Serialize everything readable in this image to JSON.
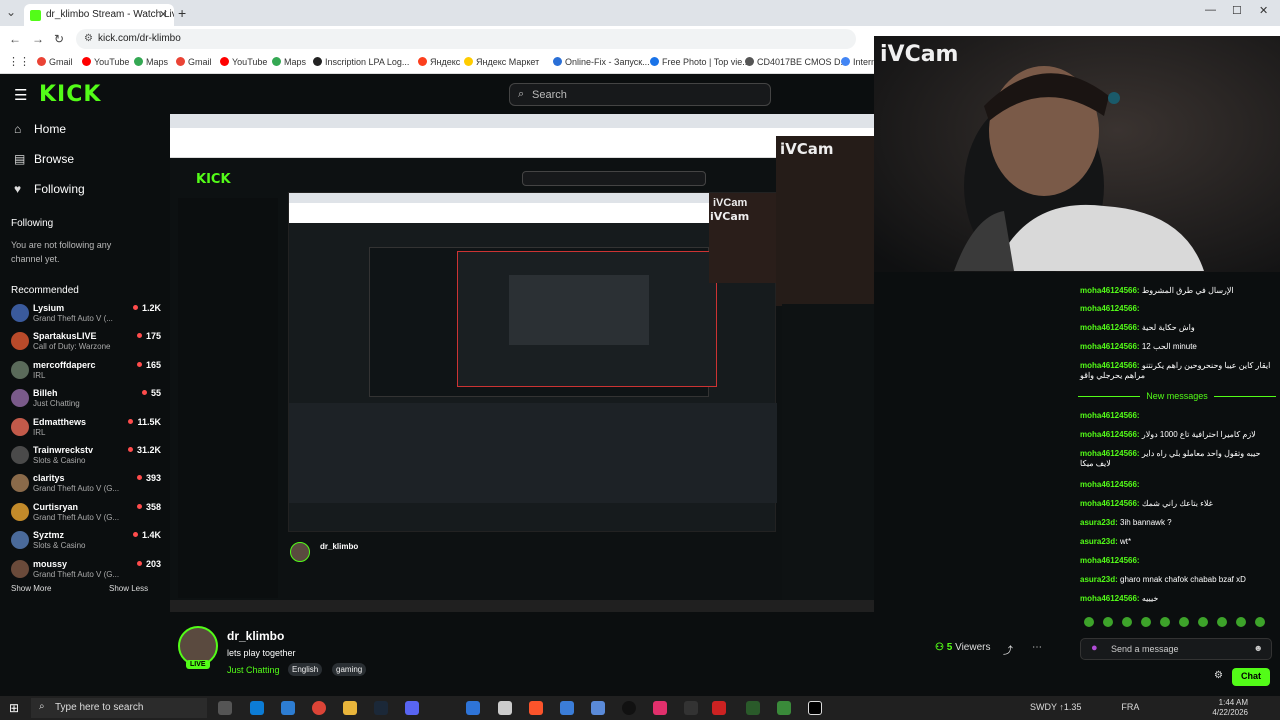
{
  "browser": {
    "tab_title": "dr_klimbo Stream - Watch Live",
    "url": "kick.com/dr-klimbo",
    "bookmarks": [
      "Gmail",
      "YouTube",
      "Maps",
      "Gmail",
      "YouTube",
      "Maps",
      "Inscription LPA Log...",
      "Яндекс",
      "Яндекс Маркет",
      "Online-Fix - Запуск...",
      "Free Photo | Top vie...",
      "CD4017BE CMOS D...",
      "Intern"
    ]
  },
  "header": {
    "logo": "KICK",
    "search_placeholder": "Search"
  },
  "sidebar": {
    "nav": [
      {
        "label": "Home",
        "icon": "home-icon"
      },
      {
        "label": "Browse",
        "icon": "browse-icon"
      },
      {
        "label": "Following",
        "icon": "heart-icon"
      }
    ],
    "following_title": "Following",
    "following_empty": "You are not following any channel yet.",
    "recommended_title": "Recommended",
    "recommended": [
      {
        "name": "Lysium",
        "category": "Grand Theft Auto V (...",
        "viewers": "1.2K",
        "color": "#3a5a9c"
      },
      {
        "name": "SpartakusLIVE",
        "category": "Call of Duty: Warzone",
        "viewers": "175",
        "color": "#b84a2a"
      },
      {
        "name": "mercoffdaperc",
        "category": "IRL",
        "viewers": "165",
        "color": "#5a6a5a"
      },
      {
        "name": "Billeh",
        "category": "Just Chatting",
        "viewers": "55",
        "color": "#7a5a8a"
      },
      {
        "name": "Edmatthews",
        "category": "IRL",
        "viewers": "11.5K",
        "color": "#c25a4a"
      },
      {
        "name": "Trainwreckstv",
        "category": "Slots & Casino",
        "viewers": "31.2K",
        "color": "#4a4a4a"
      },
      {
        "name": "claritys",
        "category": "Grand Theft Auto V (G...",
        "viewers": "393",
        "color": "#8a6a4a"
      },
      {
        "name": "Curtisryan",
        "category": "Grand Theft Auto V (G...",
        "viewers": "358",
        "color": "#c28a2a"
      },
      {
        "name": "Syztmz",
        "category": "Slots & Casino",
        "viewers": "1.4K",
        "color": "#4a6a9a"
      },
      {
        "name": "moussy",
        "category": "Grand Theft Auto V (G...",
        "viewers": "203",
        "color": "#6a4a3a"
      }
    ],
    "show_more": "Show More",
    "show_less": "Show Less"
  },
  "overlay": {
    "ivcam_label": "iVCam",
    "inner_ivcam_1": "iVCam",
    "inner_ivcam_2": "iVCam",
    "inner_ivcam_3": "iVCam"
  },
  "channel": {
    "name": "dr_klimbo",
    "live_badge": "LIVE",
    "title": "lets play together",
    "category": "Just Chatting",
    "tags": [
      "English",
      "gaming"
    ],
    "viewers": "5",
    "viewers_label": "Viewers"
  },
  "chat": {
    "messages_top": [
      {
        "user": "moha46124566:",
        "text": "الإرسال في طرق المشروط"
      },
      {
        "user": "moha46124566:",
        "text": ""
      },
      {
        "user": "moha46124566:",
        "text": "واش حكاية لحية"
      },
      {
        "user": "moha46124566:",
        "text": "الحب 12 minute"
      },
      {
        "user": "moha46124566:",
        "text": "ايقار كاين عيبا وحنحروحين راهم يكرنتنو مراهم يحرجلي واقو"
      }
    ],
    "new_messages_label": "New messages",
    "messages_bottom": [
      {
        "user": "moha46124566:",
        "text": ""
      },
      {
        "user": "moha46124566:",
        "text": "لازم كاميرا احترافية تاع 1000 دولار"
      },
      {
        "user": "moha46124566:",
        "text": "حيبه وتقول واحد معاملو بلي راه داير لايف ميكا"
      },
      {
        "user": "moha46124566:",
        "text": ""
      },
      {
        "user": "moha46124566:",
        "text": "غلاء بتاعك راني شمك"
      },
      {
        "user": "asura23d:",
        "text": "3ih bannawk ?"
      },
      {
        "user": "asura23d:",
        "text": "wt*"
      },
      {
        "user": "moha46124566:",
        "text": ""
      },
      {
        "user": "asura23d:",
        "text": "gharo mnak chafok chabab bzaf xD"
      },
      {
        "user": "moha46124566:",
        "text": "خيييه"
      }
    ],
    "input_placeholder": "Send a message",
    "chat_button": "Chat"
  },
  "taskbar": {
    "search_placeholder": "Type here to search",
    "tray_text": "SWDY ↑1.35",
    "lang": "FRA",
    "time": "1:44 AM",
    "date": "4/22/2026"
  }
}
